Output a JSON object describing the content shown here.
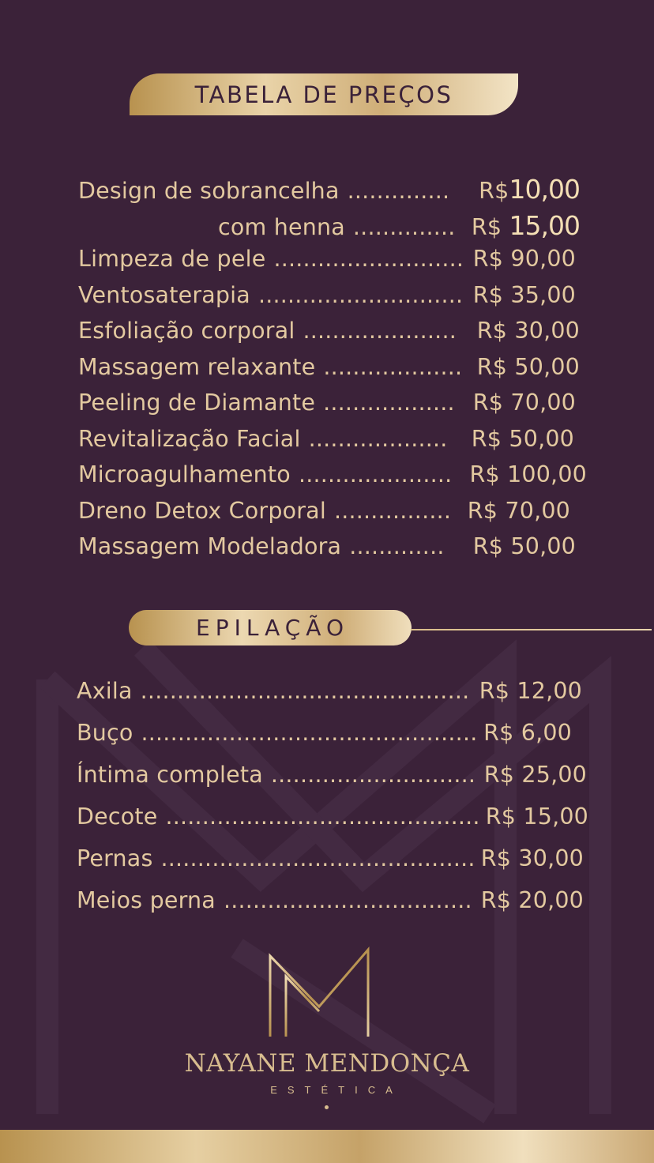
{
  "title": "TABELA DE PREÇOS",
  "services": [
    {
      "name": "Design de sobrancelha",
      "dots": "..............",
      "currency": "R$",
      "value": "10,00",
      "emphasis": true
    },
    {
      "name": "com henna",
      "dots": "..............",
      "currency": "R$",
      "value": "15,00",
      "emphasis": true
    },
    {
      "name": "Limpeza de pele",
      "dots": "..........................",
      "currency": "R$",
      "value": "90,00"
    },
    {
      "name": "Ventosaterapia",
      "dots": "............................",
      "currency": "R$",
      "value": "35,00"
    },
    {
      "name": "Esfoliação corporal",
      "dots": ".....................",
      "currency": "R$",
      "value": "30,00"
    },
    {
      "name": "Massagem relaxante",
      "dots": "...................",
      "currency": "R$",
      "value": "50,00"
    },
    {
      "name": "Peeling de Diamante",
      "dots": "..................",
      "currency": "R$",
      "value": "70,00"
    },
    {
      "name": "Revitalização Facial",
      "dots": "...................",
      "currency": "R$",
      "value": "50,00"
    },
    {
      "name": "Microagulhamento",
      "dots": ".....................",
      "currency": "R$",
      "value": "100,00"
    },
    {
      "name": "Dreno Detox Corporal",
      "dots": "................",
      "currency": "R$",
      "value": "70,00"
    },
    {
      "name": "Massagem Modeladora",
      "dots": ".............",
      "currency": "R$",
      "value": "50,00"
    }
  ],
  "epilacao_title": "EPILAÇÃO",
  "epilacao": [
    {
      "name": "Axila",
      "dots": "...............................................",
      "currency": "R$",
      "value": "12,00"
    },
    {
      "name": "Buço",
      "dots": "...............................................",
      "currency": "R$",
      "value": "6,00"
    },
    {
      "name": "Íntima completa",
      "dots": "............................",
      "currency": "R$",
      "value": "25,00"
    },
    {
      "name": "Decote",
      "dots": "...........................................",
      "currency": "R$",
      "value": "15,00"
    },
    {
      "name": "Pernas",
      "dots": "............................................",
      "currency": "R$",
      "value": "30,00"
    },
    {
      "name": "Meios perna",
      "dots": "..................................",
      "currency": "R$",
      "value": "20,00"
    }
  ],
  "brand": {
    "name": "NAYANE MENDONÇA",
    "subtitle": "ESTÉTICA",
    "logo_icon": "nm-monogram-icon"
  },
  "colors": {
    "background": "#3b2239",
    "gold": "#d8bd8f",
    "text": "#e3c9a0"
  }
}
